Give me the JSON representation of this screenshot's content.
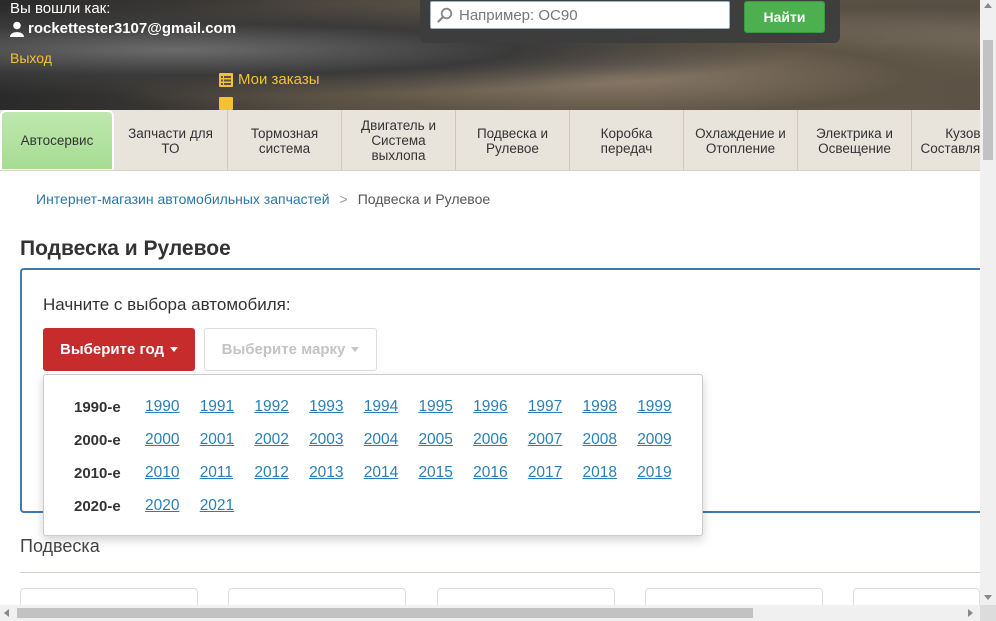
{
  "header": {
    "login_prefix": "Вы вошли как:",
    "user_email": "rockettester3107@gmail.com",
    "logout_label": "Выход",
    "orders_label": "Мои заказы",
    "accent_color": "#f2c230"
  },
  "search": {
    "placeholder": "Например: OC90",
    "button_label": "Найти",
    "button_color": "#4cb050"
  },
  "nav": {
    "items": [
      {
        "label": "Автосервис",
        "active": true
      },
      {
        "label": "Запчасти для ТО"
      },
      {
        "label": "Тормозная система"
      },
      {
        "label": "Двигатель и Система выхлопа"
      },
      {
        "label": "Подвеска и Рулевое"
      },
      {
        "label": "Коробка передач"
      },
      {
        "label": "Охлаждение и Отопление"
      },
      {
        "label": "Электрика и Освещение"
      },
      {
        "label": "Кузов и Составляющие"
      }
    ]
  },
  "breadcrumb": {
    "home": "Интернет-магазин автомобильных запчастей",
    "separator": ">",
    "current": "Подвеска и Рулевое"
  },
  "page": {
    "title": "Подвеска и Рулевое",
    "select_label": "Начните с выбора автомобиля:",
    "year_button": "Выберите год",
    "make_button": "Выберите марку",
    "year_button_color": "#c62c2c",
    "section_title": "Подвеска"
  },
  "year_dropdown": {
    "decades": [
      {
        "label": "1990-е",
        "years": [
          "1990",
          "1991",
          "1992",
          "1993",
          "1994",
          "1995",
          "1996",
          "1997",
          "1998",
          "1999"
        ]
      },
      {
        "label": "2000-е",
        "years": [
          "2000",
          "2001",
          "2002",
          "2003",
          "2004",
          "2005",
          "2006",
          "2007",
          "2008",
          "2009"
        ]
      },
      {
        "label": "2010-е",
        "years": [
          "2010",
          "2011",
          "2012",
          "2013",
          "2014",
          "2015",
          "2016",
          "2017",
          "2018",
          "2019"
        ]
      },
      {
        "label": "2020-е",
        "years": [
          "2020",
          "2021"
        ]
      }
    ]
  }
}
